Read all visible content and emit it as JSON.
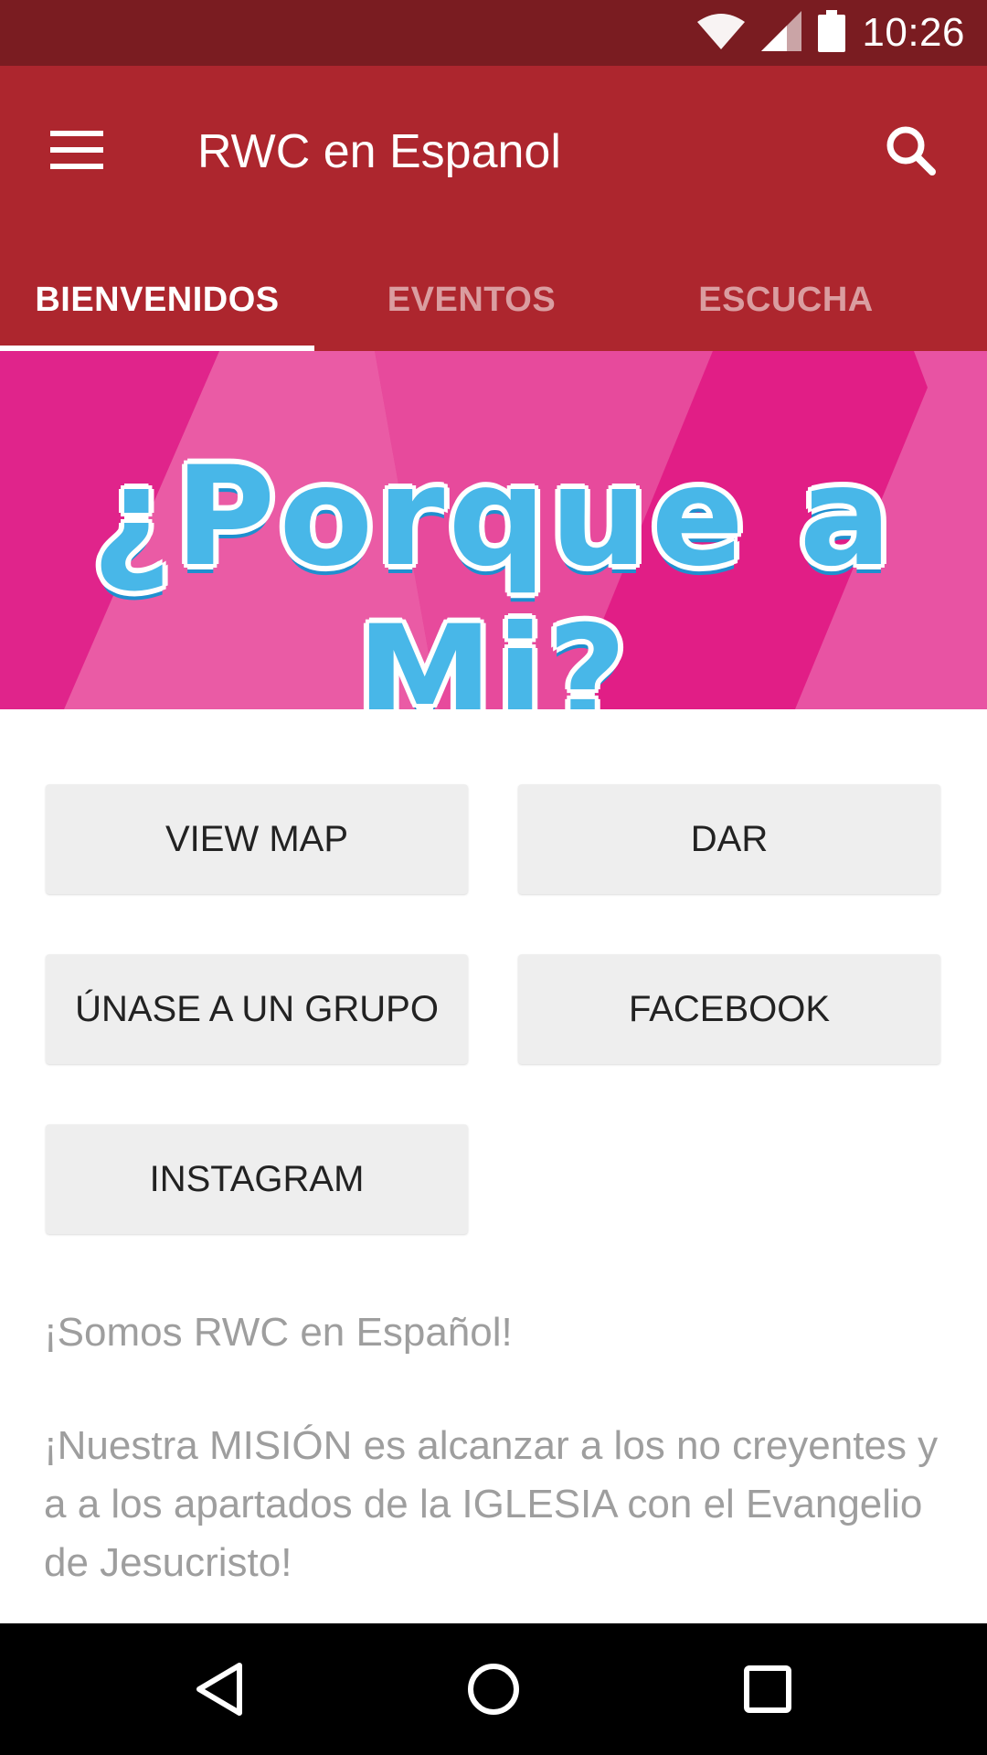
{
  "status_bar": {
    "time": "10:26",
    "icons": [
      "wifi-icon",
      "signal-icon",
      "battery-icon"
    ]
  },
  "app_bar": {
    "title": "RWC en Espanol",
    "menu_icon": "hamburger-menu-icon",
    "search_icon": "search-icon"
  },
  "tabs": [
    {
      "label": "BIENVENIDOS",
      "active": true
    },
    {
      "label": "EVENTOS",
      "active": false
    },
    {
      "label": "ESCUCHA",
      "active": false
    }
  ],
  "banner": {
    "text": "¿Porque a Mi?"
  },
  "buttons": [
    {
      "label": "VIEW MAP"
    },
    {
      "label": "DAR"
    },
    {
      "label": "ÚNASE A UN GRUPO"
    },
    {
      "label": "FACEBOOK"
    },
    {
      "label": "INSTAGRAM"
    }
  ],
  "description": {
    "line1": "¡Somos RWC en Español!",
    "line2": " ¡Nuestra MISIÓN es alcanzar a los no creyentes y a a los apartados de la IGLESIA con el Evangelio de Jesucristo!"
  },
  "nav_bar": {
    "icons": [
      "back-icon",
      "home-icon",
      "recents-icon"
    ]
  },
  "colors": {
    "status_bar": "#7a1c21",
    "app_bar": "#ad262e",
    "banner_pink": "#e53b94",
    "button_bg": "#eeeeee"
  }
}
